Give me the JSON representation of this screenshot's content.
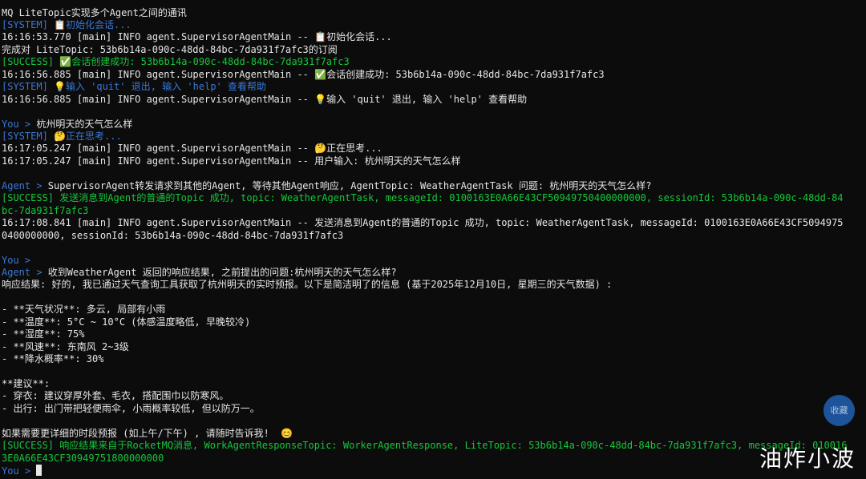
{
  "window": {
    "title": "MQ LiteTopic实现多个Agent之间的通讯"
  },
  "colors": {
    "background": "#0c0c0c",
    "text": "#e6e6e6",
    "system_tag": "#3a78d8",
    "success_tag": "#14c83a",
    "prompt": "#3a78d8",
    "floating_button": "#1f5aa6"
  },
  "lines": [
    {
      "text": "MQ LiteTopic实现多个Agent之间的通讯",
      "style": "white"
    },
    {
      "text": "[SYSTEM] 📋初始化会话...",
      "style": "system"
    },
    {
      "text": "16:16:53.770 [main] INFO agent.SupervisorAgentMain -- 📋初始化会话...",
      "style": "white"
    },
    {
      "text": "完成对 LiteTopic: 53b6b14a-090c-48dd-84bc-7da931f7afc3的订阅",
      "style": "white"
    },
    {
      "text": "[SUCCESS] ✅会话创建成功: 53b6b14a-090c-48dd-84bc-7da931f7afc3",
      "style": "success"
    },
    {
      "text": "16:16:56.885 [main] INFO agent.SupervisorAgentMain -- ✅会话创建成功: 53b6b14a-090c-48dd-84bc-7da931f7afc3",
      "style": "white"
    },
    {
      "text": "[SYSTEM] 💡输入 'quit' 退出, 输入 'help' 查看帮助",
      "style": "system"
    },
    {
      "text": "16:16:56.885 [main] INFO agent.SupervisorAgentMain -- 💡输入 'quit' 退出, 输入 'help' 查看帮助",
      "style": "white"
    },
    {
      "text": "",
      "style": "white"
    },
    {
      "prompt": "You > ",
      "text": "杭州明天的天气怎么样",
      "style": "prompt"
    },
    {
      "text": "[SYSTEM] 🤔正在思考...",
      "style": "system"
    },
    {
      "text": "16:17:05.247 [main] INFO agent.SupervisorAgentMain -- 🤔正在思考...",
      "style": "white"
    },
    {
      "text": "16:17:05.247 [main] INFO agent.SupervisorAgentMain -- 用户输入: 杭州明天的天气怎么样",
      "style": "white"
    },
    {
      "text": "",
      "style": "white"
    },
    {
      "prompt": "Agent > ",
      "text": "SupervisorAgent转发请求到其他的Agent, 等待其他Agent响应, AgentTopic: WeatherAgentTask 问题: 杭州明天的天气怎么样?",
      "style": "agent"
    },
    {
      "text": "[SUCCESS] 发送消息到Agent的普通的Topic 成功, topic: WeatherAgentTask, messageId: 0100163E0A66E43CF50949750400000000, sessionId: 53b6b14a-090c-48dd-84",
      "style": "success"
    },
    {
      "text": "bc-7da931f7afc3",
      "style": "success"
    },
    {
      "text": "16:17:08.841 [main] INFO agent.SupervisorAgentMain -- 发送消息到Agent的普通的Topic 成功, topic: WeatherAgentTask, messageId: 0100163E0A66E43CF5094975",
      "style": "white"
    },
    {
      "text": "0400000000, sessionId: 53b6b14a-090c-48dd-84bc-7da931f7afc3",
      "style": "white"
    },
    {
      "text": "",
      "style": "white"
    },
    {
      "prompt": "You > ",
      "text": "",
      "style": "prompt"
    },
    {
      "prompt": "Agent > ",
      "text": "收到WeatherAgent 返回的响应结果, 之前提出的问题:杭州明天的天气怎么样?",
      "style": "agent"
    },
    {
      "text": "响应结果: 好的, 我已通过天气查询工具获取了杭州明天的实时预报。以下是简洁明了的信息 (基于2025年12月10日, 星期三的天气数据) :",
      "style": "white"
    },
    {
      "text": "",
      "style": "white"
    },
    {
      "text": "- **天气状况**: 多云, 局部有小雨",
      "style": "white"
    },
    {
      "text": "- **温度**: 5°C ~ 10°C (体感温度略低, 早晚较冷)",
      "style": "white"
    },
    {
      "text": "- **湿度**: 75%",
      "style": "white"
    },
    {
      "text": "- **风速**: 东南风 2~3级",
      "style": "white"
    },
    {
      "text": "- **降水概率**: 30%",
      "style": "white"
    },
    {
      "text": "",
      "style": "white"
    },
    {
      "text": "**建议**:",
      "style": "white"
    },
    {
      "text": "- 穿衣: 建议穿厚外套、毛衣, 搭配围巾以防寒风。",
      "style": "white"
    },
    {
      "text": "- 出行: 出门带把轻便雨伞, 小雨概率较低, 但以防万一。",
      "style": "white"
    },
    {
      "text": "",
      "style": "white"
    },
    {
      "text": "如果需要更详细的时段预报 (如上午/下午) , 请随时告诉我!  😊",
      "style": "white"
    },
    {
      "text": "[SUCCESS] 响应结果来自于RocketMQ消息, WorkAgentResponseTopic: WorkerAgentResponse, LiteTopic: 53b6b14a-090c-48dd-84bc-7da931f7afc3, messageId: 010016",
      "style": "success"
    },
    {
      "text": "3E0A66E43CF30949751800000000",
      "style": "success"
    },
    {
      "prompt": "You > ",
      "text": "",
      "style": "prompt",
      "cursor": true
    }
  ],
  "floating_button": {
    "label": "收藏"
  },
  "watermark": {
    "text": "油炸小波"
  }
}
